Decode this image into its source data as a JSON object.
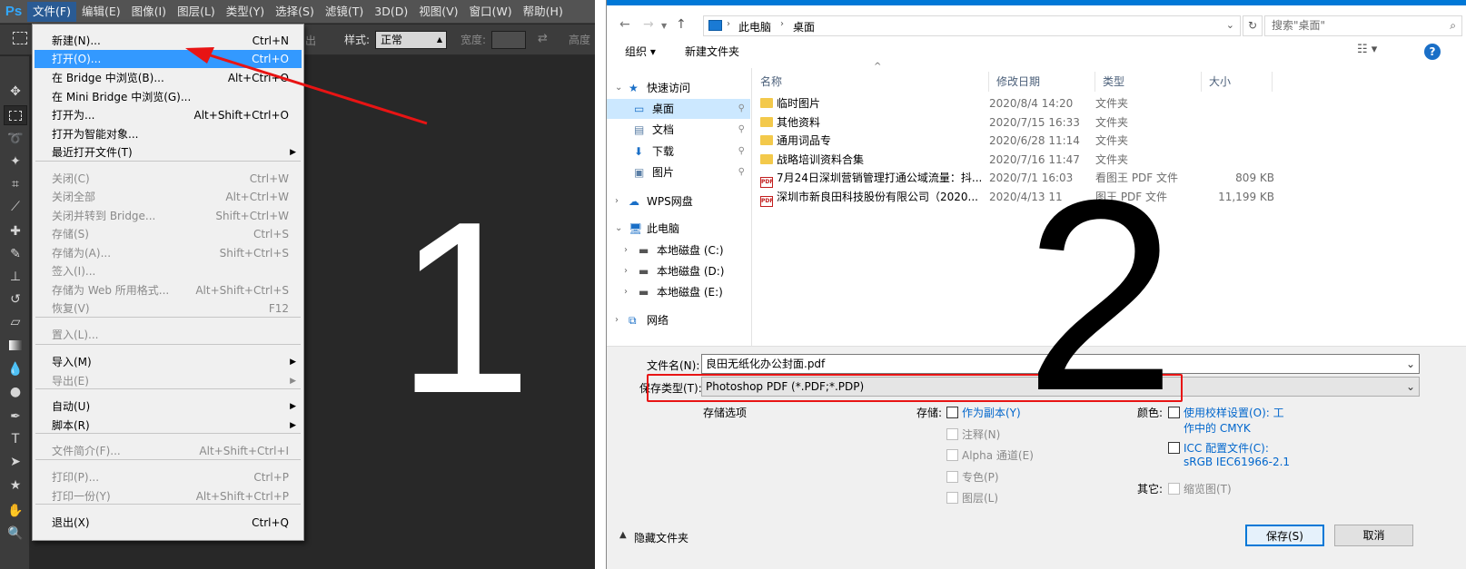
{
  "ps": {
    "logo": "Ps",
    "menus": [
      "文件(F)",
      "编辑(E)",
      "图像(I)",
      "图层(L)",
      "类型(Y)",
      "选择(S)",
      "滤镜(T)",
      "3D(D)",
      "视图(V)",
      "窗口(W)",
      "帮助(H)"
    ],
    "options": {
      "style_label": "样式:",
      "style_value": "正常",
      "width_label": "宽度:",
      "height_label": "高度",
      "fragment": "出"
    },
    "file_menu": [
      {
        "label": "新建(N)...",
        "shortcut": "Ctrl+N",
        "disabled": false
      },
      {
        "label": "打开(O)...",
        "shortcut": "Ctrl+O",
        "disabled": false,
        "highlighted": true
      },
      {
        "label": "在 Bridge 中浏览(B)...",
        "shortcut": "Alt+Ctrl+O",
        "disabled": false
      },
      {
        "label": "在 Mini Bridge 中浏览(G)...",
        "shortcut": "",
        "disabled": false
      },
      {
        "label": "打开为...",
        "shortcut": "Alt+Shift+Ctrl+O",
        "disabled": false
      },
      {
        "label": "打开为智能对象...",
        "shortcut": "",
        "disabled": false
      },
      {
        "label": "最近打开文件(T)",
        "shortcut": "",
        "disabled": false,
        "submenu": true
      },
      {
        "label": "关闭(C)",
        "shortcut": "Ctrl+W",
        "disabled": true
      },
      {
        "label": "关闭全部",
        "shortcut": "Alt+Ctrl+W",
        "disabled": true
      },
      {
        "label": "关闭并转到 Bridge...",
        "shortcut": "Shift+Ctrl+W",
        "disabled": true
      },
      {
        "label": "存储(S)",
        "shortcut": "Ctrl+S",
        "disabled": true
      },
      {
        "label": "存储为(A)...",
        "shortcut": "Shift+Ctrl+S",
        "disabled": true
      },
      {
        "label": "签入(I)...",
        "shortcut": "",
        "disabled": true
      },
      {
        "label": "存储为 Web 所用格式...",
        "shortcut": "Alt+Shift+Ctrl+S",
        "disabled": true
      },
      {
        "label": "恢复(V)",
        "shortcut": "F12",
        "disabled": true
      },
      {
        "label": "置入(L)...",
        "shortcut": "",
        "disabled": true
      },
      {
        "label": "导入(M)",
        "shortcut": "",
        "disabled": false,
        "submenu": true
      },
      {
        "label": "导出(E)",
        "shortcut": "",
        "disabled": true,
        "submenu": true
      },
      {
        "label": "自动(U)",
        "shortcut": "",
        "disabled": false,
        "submenu": true
      },
      {
        "label": "脚本(R)",
        "shortcut": "",
        "disabled": false,
        "submenu": true
      },
      {
        "label": "文件简介(F)...",
        "shortcut": "Alt+Shift+Ctrl+I",
        "disabled": true
      },
      {
        "label": "打印(P)...",
        "shortcut": "Ctrl+P",
        "disabled": true
      },
      {
        "label": "打印一份(Y)",
        "shortcut": "Alt+Shift+Ctrl+P",
        "disabled": true
      },
      {
        "label": "退出(X)",
        "shortcut": "Ctrl+Q",
        "disabled": false
      }
    ],
    "big_number": "1"
  },
  "dialog": {
    "breadcrumb": [
      "此电脑",
      "桌面"
    ],
    "search_placeholder": "搜索\"桌面\"",
    "toolbar": {
      "organize": "组织 ▾",
      "new_folder": "新建文件夹",
      "help": "?"
    },
    "nav": [
      {
        "label": "快速访问",
        "icon": "star-icon",
        "level": 0,
        "expanded": true
      },
      {
        "label": "桌面",
        "icon": "desktop-icon",
        "level": 1,
        "pinned": true,
        "selected": true
      },
      {
        "label": "文档",
        "icon": "document-icon",
        "level": 1,
        "pinned": true
      },
      {
        "label": "下载",
        "icon": "download-icon",
        "level": 1,
        "pinned": true
      },
      {
        "label": "图片",
        "icon": "picture-icon",
        "level": 1,
        "pinned": true
      },
      {
        "label": "WPS网盘",
        "icon": "cloud-icon",
        "level": 0,
        "expanded": false
      },
      {
        "label": "此电脑",
        "icon": "computer-icon",
        "level": 0,
        "expanded": true
      },
      {
        "label": "本地磁盘 (C:)",
        "icon": "drive-icon",
        "level": 1,
        "expanded": false
      },
      {
        "label": "本地磁盘 (D:)",
        "icon": "drive-icon",
        "level": 1,
        "expanded": false
      },
      {
        "label": "本地磁盘 (E:)",
        "icon": "drive-icon",
        "level": 1,
        "expanded": false
      },
      {
        "label": "网络",
        "icon": "network-icon",
        "level": 0,
        "expanded": false
      }
    ],
    "columns": [
      "名称",
      "修改日期",
      "类型",
      "大小"
    ],
    "files": [
      {
        "name": "临时图片",
        "date": "2020/8/4 14:20",
        "type": "文件夹",
        "size": "",
        "kind": "folder"
      },
      {
        "name": "其他资料",
        "date": "2020/7/15 16:33",
        "type": "文件夹",
        "size": "",
        "kind": "folder"
      },
      {
        "name": "通用词品专",
        "date": "2020/6/28 11:14",
        "type": "文件夹",
        "size": "",
        "kind": "folder"
      },
      {
        "name": "战略培训资料合集",
        "date": "2020/7/16 11:47",
        "type": "文件夹",
        "size": "",
        "kind": "folder"
      },
      {
        "name": "7月24日深圳营销管理打通公域流量：抖...",
        "date": "2020/7/1 16:03",
        "type": "看图王 PDF 文件",
        "size": "809 KB",
        "kind": "pdf"
      },
      {
        "name": "深圳市新良田科技股份有限公司（2020...",
        "date": "2020/4/13 11",
        "type": "图王 PDF 文件",
        "size": "11,199 KB",
        "kind": "pdf"
      }
    ],
    "filename_label": "文件名(N):",
    "filename_value": "良田无纸化办公封面.pdf",
    "filetype_label": "保存类型(T):",
    "filetype_value": "Photoshop PDF (*.PDF;*.PDP)",
    "save_options_label": "存储选项",
    "store_label": "存储:",
    "store_options": [
      {
        "label": "作为副本(Y)",
        "enabled": true
      },
      {
        "label": "注释(N)",
        "enabled": false
      },
      {
        "label": "Alpha 通道(E)",
        "enabled": false
      },
      {
        "label": "专色(P)",
        "enabled": false
      },
      {
        "label": "图层(L)",
        "enabled": false
      }
    ],
    "color_label": "颜色:",
    "proof_line1": "使用校样设置(O): 工",
    "proof_line2": "作中的 CMYK",
    "icc_line1": "ICC 配置文件(C):",
    "icc_line2": "sRGB IEC61966-2.1",
    "other_label": "其它:",
    "thumbnail_label": "缩览图(T)",
    "hide_folders": "隐藏文件夹",
    "save_button": "保存(S)",
    "cancel_button": "取消",
    "big_number": "2"
  },
  "colors": {
    "annotation_red": "#e81414",
    "menu_highlight": "#3399ff",
    "link_blue": "#0066cc"
  }
}
